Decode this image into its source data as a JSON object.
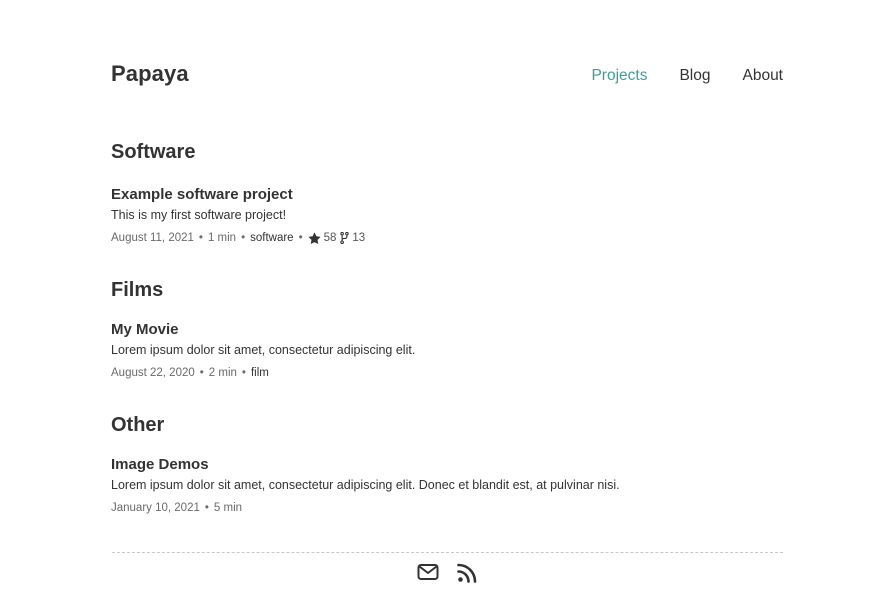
{
  "header": {
    "site_title": "Papaya",
    "nav": [
      {
        "label": "Projects",
        "active": true
      },
      {
        "label": "Blog",
        "active": false
      },
      {
        "label": "About",
        "active": false
      }
    ]
  },
  "sections": [
    {
      "heading": "Software",
      "posts": [
        {
          "title": "Example software project",
          "description": "This is my first software project!",
          "date": "August 11, 2021",
          "read_time": "1 min",
          "tag": "software",
          "stars": "58",
          "forks": "13"
        }
      ]
    },
    {
      "heading": "Films",
      "posts": [
        {
          "title": "My Movie",
          "description": "Lorem ipsum dolor sit amet, consectetur adipiscing elit.",
          "date": "August 22, 2020",
          "read_time": "2 min",
          "tag": "film"
        }
      ]
    },
    {
      "heading": "Other",
      "posts": [
        {
          "title": "Image Demos",
          "description": "Lorem ipsum dolor sit amet, consectetur adipiscing elit. Donec et blandit est, at pulvinar nisi.",
          "date": "January 10, 2021",
          "read_time": "5 min"
        }
      ]
    }
  ],
  "meta_separator": "•",
  "footer": {
    "icons": [
      "envelope-icon",
      "rss-icon"
    ]
  },
  "colors": {
    "accent": "#3f9e96",
    "text": "#333333",
    "muted": "#6a6a6a"
  }
}
